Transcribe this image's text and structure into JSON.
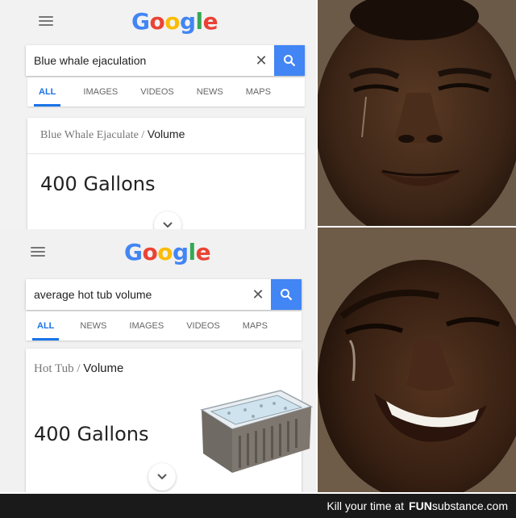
{
  "top": {
    "logo": "Google",
    "search_value": "Blue whale ejaculation",
    "tabs": [
      "ALL",
      "IMAGES",
      "VIDEOS",
      "NEWS",
      "MAPS"
    ],
    "active_tab": "ALL",
    "crumb_parent": "Blue Whale Ejaculate",
    "crumb_sep": "/",
    "crumb_current": "Volume",
    "answer": "400 Gallons"
  },
  "bottom": {
    "logo": "Google",
    "search_value": "average hot tub volume",
    "tabs": [
      "ALL",
      "NEWS",
      "IMAGES",
      "VIDEOS",
      "MAPS"
    ],
    "active_tab": "ALL",
    "crumb_parent": "Hot Tub",
    "crumb_sep": "/",
    "crumb_current": "Volume",
    "answer": "400 Gallons"
  },
  "footer": {
    "prefix": "Kill your time at",
    "brand_fun": "FUN",
    "brand_sub": "substance",
    "domain": ".com"
  },
  "colors": {
    "google_blue": "#4285f4",
    "google_red": "#ea4335",
    "google_yellow": "#fbbc05",
    "google_green": "#34a853",
    "active_tab": "#1a73e8"
  }
}
